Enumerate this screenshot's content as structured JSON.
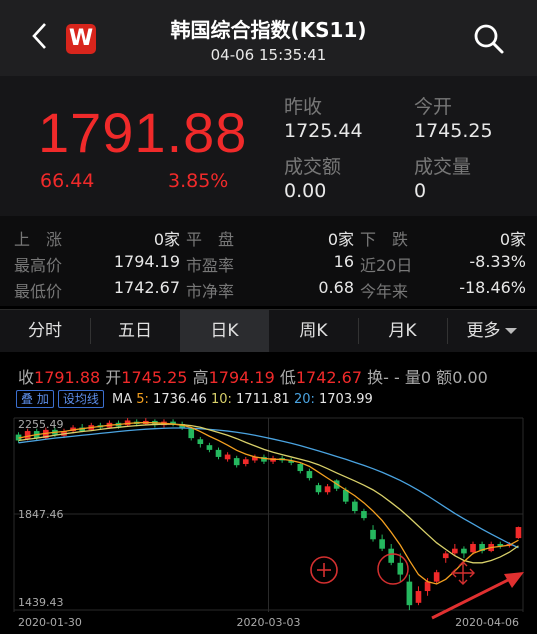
{
  "header": {
    "title": "韩国综合指数(KS11)",
    "datetime": "04-06 15:35:41",
    "logo_letter": "W",
    "back_icon": "chevron-left-icon",
    "search_icon": "search-icon"
  },
  "quote": {
    "price": "1791.88",
    "change": "66.44",
    "change_pct": "3.85%",
    "prev_close_label": "昨收",
    "prev_close": "1725.44",
    "open_label": "今开",
    "open": "1745.25",
    "turnover_label": "成交额",
    "turnover": "0.00",
    "volume_label": "成交量",
    "volume": "0"
  },
  "stats": {
    "up_label": "上　涨",
    "up": "0家",
    "flat_label": "平　盘",
    "flat": "0家",
    "down_label": "下　跌",
    "down": "0家",
    "high_label": "最高价",
    "high": "1794.19",
    "pe_label": "市盈率",
    "pe": "16",
    "d20_label": "近20日",
    "d20": "-8.33%",
    "low_label": "最低价",
    "low": "1742.67",
    "pb_label": "市净率",
    "pb": "0.68",
    "ytd_label": "今年来",
    "ytd": "-18.46%"
  },
  "tabs": [
    "分时",
    "五日",
    "日K",
    "周K",
    "月K",
    "更多"
  ],
  "active_tab": 2,
  "kline_info": {
    "close_label": "收",
    "close": "1791.88",
    "open_label": "开",
    "open": "1745.25",
    "high_label": "高",
    "high": "1794.19",
    "low_label": "低",
    "low": "1742.67",
    "turnover_label": "换",
    "turnover": "- -",
    "volume_label": "量",
    "volume": "0",
    "amount_label": "额",
    "amount": "0.00"
  },
  "ma": {
    "overlay_btn": "叠 加",
    "ma_btn": "设均线",
    "label": "MA",
    "ma5_label": "5",
    "ma5": "1736.46",
    "ma10_label": "10",
    "ma10": "1711.81",
    "ma20_label": "20",
    "ma20": "1703.99"
  },
  "colors": {
    "up": "#f02a2a",
    "down": "#25b85f",
    "ma5": "#f4a020",
    "ma10": "#d8d06a",
    "ma20": "#4aa3e0"
  },
  "chart_data": {
    "type": "candlestick",
    "y_axis_labels": [
      "2255.49",
      "1847.46",
      "1439.43"
    ],
    "x_axis_labels": [
      "2020-01-30",
      "2020-03-03",
      "2020-04-06"
    ],
    "ylim": [
      1439.43,
      2255.49
    ],
    "candles": [
      {
        "o": 2185,
        "c": 2160,
        "h": 2195,
        "l": 2150
      },
      {
        "o": 2165,
        "c": 2200,
        "h": 2210,
        "l": 2160
      },
      {
        "o": 2200,
        "c": 2170,
        "h": 2210,
        "l": 2160
      },
      {
        "o": 2170,
        "c": 2205,
        "h": 2215,
        "l": 2165
      },
      {
        "o": 2205,
        "c": 2185,
        "h": 2215,
        "l": 2175
      },
      {
        "o": 2180,
        "c": 2200,
        "h": 2210,
        "l": 2170
      },
      {
        "o": 2200,
        "c": 2215,
        "h": 2225,
        "l": 2190
      },
      {
        "o": 2215,
        "c": 2200,
        "h": 2230,
        "l": 2195
      },
      {
        "o": 2205,
        "c": 2225,
        "h": 2235,
        "l": 2200
      },
      {
        "o": 2225,
        "c": 2215,
        "h": 2235,
        "l": 2205
      },
      {
        "o": 2215,
        "c": 2235,
        "h": 2245,
        "l": 2210
      },
      {
        "o": 2235,
        "c": 2220,
        "h": 2245,
        "l": 2210
      },
      {
        "o": 2225,
        "c": 2245,
        "h": 2255,
        "l": 2220
      },
      {
        "o": 2240,
        "c": 2230,
        "h": 2250,
        "l": 2220
      },
      {
        "o": 2230,
        "c": 2243,
        "h": 2255,
        "l": 2225
      },
      {
        "o": 2243,
        "c": 2225,
        "h": 2250,
        "l": 2215
      },
      {
        "o": 2225,
        "c": 2240,
        "h": 2250,
        "l": 2215
      },
      {
        "o": 2240,
        "c": 2228,
        "h": 2250,
        "l": 2220
      },
      {
        "o": 2230,
        "c": 2215,
        "h": 2240,
        "l": 2205
      },
      {
        "o": 2210,
        "c": 2170,
        "h": 2215,
        "l": 2160
      },
      {
        "o": 2165,
        "c": 2145,
        "h": 2175,
        "l": 2130
      },
      {
        "o": 2140,
        "c": 2120,
        "h": 2150,
        "l": 2110
      },
      {
        "o": 2120,
        "c": 2090,
        "h": 2130,
        "l": 2080
      },
      {
        "o": 2080,
        "c": 2100,
        "h": 2110,
        "l": 2070
      },
      {
        "o": 2085,
        "c": 2055,
        "h": 2095,
        "l": 2045
      },
      {
        "o": 2060,
        "c": 2080,
        "h": 2090,
        "l": 2050
      },
      {
        "o": 2075,
        "c": 2090,
        "h": 2100,
        "l": 2065
      },
      {
        "o": 2090,
        "c": 2070,
        "h": 2100,
        "l": 2060
      },
      {
        "o": 2070,
        "c": 2085,
        "h": 2095,
        "l": 2060
      },
      {
        "o": 2085,
        "c": 2075,
        "h": 2095,
        "l": 2065
      },
      {
        "o": 2075,
        "c": 2065,
        "h": 2085,
        "l": 2055
      },
      {
        "o": 2060,
        "c": 2030,
        "h": 2065,
        "l": 2020
      },
      {
        "o": 2030,
        "c": 2000,
        "h": 2040,
        "l": 1990
      },
      {
        "o": 1970,
        "c": 1940,
        "h": 1980,
        "l": 1930
      },
      {
        "o": 1940,
        "c": 1965,
        "h": 1975,
        "l": 1930
      },
      {
        "o": 1990,
        "c": 1955,
        "h": 1995,
        "l": 1945
      },
      {
        "o": 1950,
        "c": 1900,
        "h": 1960,
        "l": 1890
      },
      {
        "o": 1900,
        "c": 1860,
        "h": 1910,
        "l": 1850
      },
      {
        "o": 1860,
        "c": 1830,
        "h": 1870,
        "l": 1820
      },
      {
        "o": 1780,
        "c": 1740,
        "h": 1800,
        "l": 1730
      },
      {
        "o": 1740,
        "c": 1700,
        "h": 1760,
        "l": 1690
      },
      {
        "o": 1700,
        "c": 1640,
        "h": 1720,
        "l": 1630
      },
      {
        "o": 1640,
        "c": 1590,
        "h": 1680,
        "l": 1560
      },
      {
        "o": 1560,
        "c": 1460,
        "h": 1590,
        "l": 1439
      },
      {
        "o": 1470,
        "c": 1520,
        "h": 1540,
        "l": 1460
      },
      {
        "o": 1520,
        "c": 1560,
        "h": 1575,
        "l": 1500
      },
      {
        "o": 1560,
        "c": 1600,
        "h": 1610,
        "l": 1550
      },
      {
        "o": 1660,
        "c": 1680,
        "h": 1690,
        "l": 1640
      },
      {
        "o": 1680,
        "c": 1700,
        "h": 1720,
        "l": 1670
      },
      {
        "o": 1700,
        "c": 1680,
        "h": 1710,
        "l": 1660
      },
      {
        "o": 1685,
        "c": 1720,
        "h": 1730,
        "l": 1675
      },
      {
        "o": 1720,
        "c": 1690,
        "h": 1730,
        "l": 1680
      },
      {
        "o": 1690,
        "c": 1720,
        "h": 1730,
        "l": 1685
      },
      {
        "o": 1720,
        "c": 1710,
        "h": 1730,
        "l": 1700
      },
      {
        "o": 1712,
        "c": 1720,
        "h": 1728,
        "l": 1705
      },
      {
        "o": 1745,
        "c": 1792,
        "h": 1794,
        "l": 1742
      }
    ],
    "ma5": [
      2170,
      2178,
      2185,
      2190,
      2195,
      2198,
      2205,
      2210,
      2215,
      2220,
      2225,
      2228,
      2232,
      2235,
      2236,
      2235,
      2233,
      2230,
      2225,
      2215,
      2198,
      2178,
      2160,
      2140,
      2118,
      2102,
      2090,
      2084,
      2080,
      2080,
      2075,
      2066,
      2050,
      2025,
      2000,
      1975,
      1950,
      1925,
      1895,
      1860,
      1820,
      1770,
      1715,
      1650,
      1590,
      1560,
      1550,
      1570,
      1605,
      1645,
      1680,
      1695,
      1705,
      1710,
      1715,
      1736
    ],
    "ma10": [
      2160,
      2165,
      2170,
      2176,
      2182,
      2188,
      2193,
      2198,
      2202,
      2207,
      2212,
      2216,
      2220,
      2223,
      2226,
      2228,
      2229,
      2229,
      2227,
      2223,
      2216,
      2205,
      2194,
      2182,
      2168,
      2152,
      2137,
      2122,
      2110,
      2100,
      2090,
      2080,
      2070,
      2057,
      2040,
      2022,
      2005,
      1988,
      1970,
      1950,
      1925,
      1896,
      1866,
      1832,
      1796,
      1760,
      1725,
      1697,
      1670,
      1650,
      1640,
      1640,
      1650,
      1665,
      1685,
      1712
    ],
    "ma20": [
      2150,
      2155,
      2160,
      2165,
      2170,
      2174,
      2178,
      2182,
      2186,
      2190,
      2194,
      2198,
      2202,
      2205,
      2208,
      2210,
      2212,
      2213,
      2213,
      2212,
      2210,
      2207,
      2204,
      2200,
      2195,
      2189,
      2182,
      2174,
      2166,
      2157,
      2148,
      2138,
      2127,
      2116,
      2104,
      2092,
      2080,
      2067,
      2054,
      2040,
      2025,
      2008,
      1990,
      1970,
      1948,
      1925,
      1900,
      1875,
      1850,
      1827,
      1805,
      1783,
      1762,
      1742,
      1722,
      1704
    ]
  }
}
